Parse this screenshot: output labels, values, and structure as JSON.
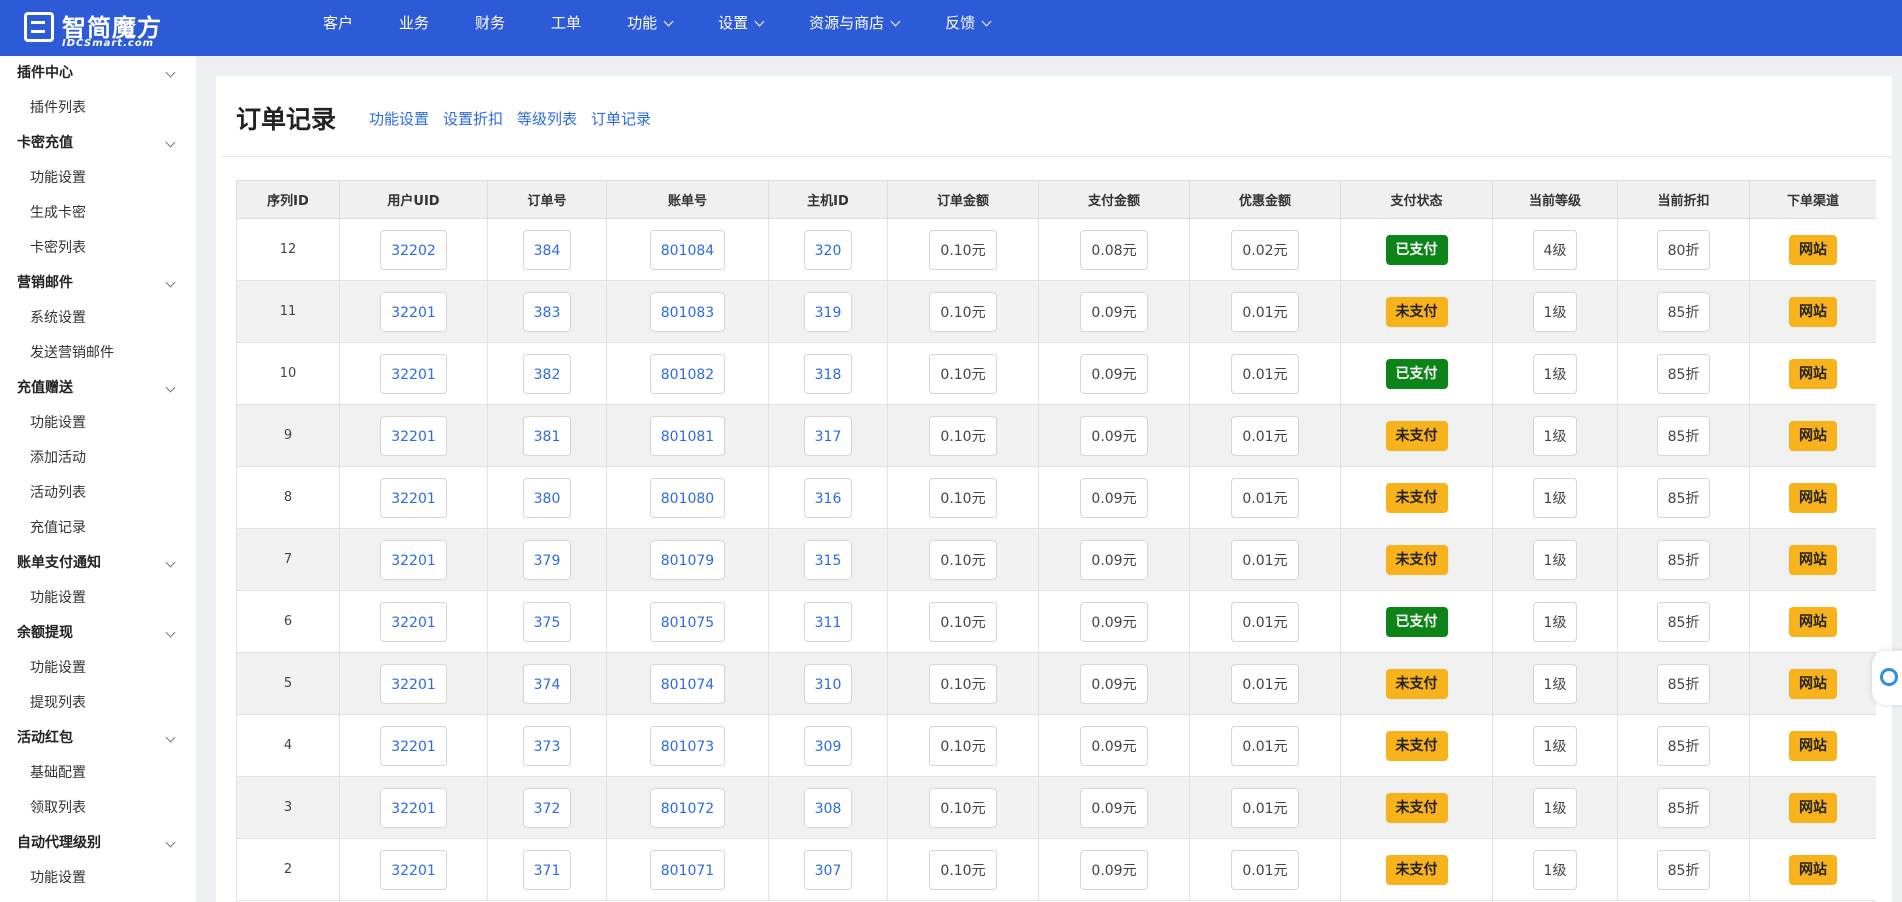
{
  "brand": {
    "name": "智简魔方",
    "sub": "IDCSmart.com"
  },
  "nav": [
    {
      "label": "客户",
      "dropdown": false
    },
    {
      "label": "业务",
      "dropdown": false
    },
    {
      "label": "财务",
      "dropdown": false
    },
    {
      "label": "工单",
      "dropdown": false
    },
    {
      "label": "功能",
      "dropdown": true
    },
    {
      "label": "设置",
      "dropdown": true
    },
    {
      "label": "资源与商店",
      "dropdown": true
    },
    {
      "label": "反馈",
      "dropdown": true
    }
  ],
  "sidebar": [
    {
      "group": "插件中心",
      "items": [
        "插件列表"
      ]
    },
    {
      "group": "卡密充值",
      "items": [
        "功能设置",
        "生成卡密",
        "卡密列表"
      ]
    },
    {
      "group": "营销邮件",
      "items": [
        "系统设置",
        "发送营销邮件"
      ]
    },
    {
      "group": "充值赠送",
      "items": [
        "功能设置",
        "添加活动",
        "活动列表",
        "充值记录"
      ]
    },
    {
      "group": "账单支付通知",
      "items": [
        "功能设置"
      ]
    },
    {
      "group": "余额提现",
      "items": [
        "功能设置",
        "提现列表"
      ]
    },
    {
      "group": "活动红包",
      "items": [
        "基础配置",
        "领取列表"
      ]
    },
    {
      "group": "自动代理级别",
      "items": [
        "功能设置"
      ]
    }
  ],
  "page": {
    "title": "订单记录",
    "tabs": [
      "功能设置",
      "设置折扣",
      "等级列表",
      "订单记录"
    ]
  },
  "table": {
    "headers": [
      "序列ID",
      "用户UID",
      "订单号",
      "账单号",
      "主机ID",
      "订单金额",
      "支付金额",
      "优惠金额",
      "支付状态",
      "当前等级",
      "当前折扣",
      "下单渠道"
    ],
    "rows": [
      {
        "id": "12",
        "uid": "32202",
        "order": "384",
        "bill": "801084",
        "host": "320",
        "amount": "0.10元",
        "paid": "0.08元",
        "discount": "0.02元",
        "status": "已支付",
        "level": "4级",
        "rate": "80折",
        "channel": "网站"
      },
      {
        "id": "11",
        "uid": "32201",
        "order": "383",
        "bill": "801083",
        "host": "319",
        "amount": "0.10元",
        "paid": "0.09元",
        "discount": "0.01元",
        "status": "未支付",
        "level": "1级",
        "rate": "85折",
        "channel": "网站"
      },
      {
        "id": "10",
        "uid": "32201",
        "order": "382",
        "bill": "801082",
        "host": "318",
        "amount": "0.10元",
        "paid": "0.09元",
        "discount": "0.01元",
        "status": "已支付",
        "level": "1级",
        "rate": "85折",
        "channel": "网站"
      },
      {
        "id": "9",
        "uid": "32201",
        "order": "381",
        "bill": "801081",
        "host": "317",
        "amount": "0.10元",
        "paid": "0.09元",
        "discount": "0.01元",
        "status": "未支付",
        "level": "1级",
        "rate": "85折",
        "channel": "网站"
      },
      {
        "id": "8",
        "uid": "32201",
        "order": "380",
        "bill": "801080",
        "host": "316",
        "amount": "0.10元",
        "paid": "0.09元",
        "discount": "0.01元",
        "status": "未支付",
        "level": "1级",
        "rate": "85折",
        "channel": "网站"
      },
      {
        "id": "7",
        "uid": "32201",
        "order": "379",
        "bill": "801079",
        "host": "315",
        "amount": "0.10元",
        "paid": "0.09元",
        "discount": "0.01元",
        "status": "未支付",
        "level": "1级",
        "rate": "85折",
        "channel": "网站"
      },
      {
        "id": "6",
        "uid": "32201",
        "order": "375",
        "bill": "801075",
        "host": "311",
        "amount": "0.10元",
        "paid": "0.09元",
        "discount": "0.01元",
        "status": "已支付",
        "level": "1级",
        "rate": "85折",
        "channel": "网站"
      },
      {
        "id": "5",
        "uid": "32201",
        "order": "374",
        "bill": "801074",
        "host": "310",
        "amount": "0.10元",
        "paid": "0.09元",
        "discount": "0.01元",
        "status": "未支付",
        "level": "1级",
        "rate": "85折",
        "channel": "网站"
      },
      {
        "id": "4",
        "uid": "32201",
        "order": "373",
        "bill": "801073",
        "host": "309",
        "amount": "0.10元",
        "paid": "0.09元",
        "discount": "0.01元",
        "status": "未支付",
        "level": "1级",
        "rate": "85折",
        "channel": "网站"
      },
      {
        "id": "3",
        "uid": "32201",
        "order": "372",
        "bill": "801072",
        "host": "308",
        "amount": "0.10元",
        "paid": "0.09元",
        "discount": "0.01元",
        "status": "未支付",
        "level": "1级",
        "rate": "85折",
        "channel": "网站"
      },
      {
        "id": "2",
        "uid": "32201",
        "order": "371",
        "bill": "801071",
        "host": "307",
        "amount": "0.10元",
        "paid": "0.09元",
        "discount": "0.01元",
        "status": "未支付",
        "level": "1级",
        "rate": "85折",
        "channel": "网站"
      }
    ]
  },
  "colors": {
    "topbar": "#2d5bd7",
    "link": "#2d6ce0",
    "paid": "#0c8418",
    "unpaid": "#f7b21c"
  }
}
